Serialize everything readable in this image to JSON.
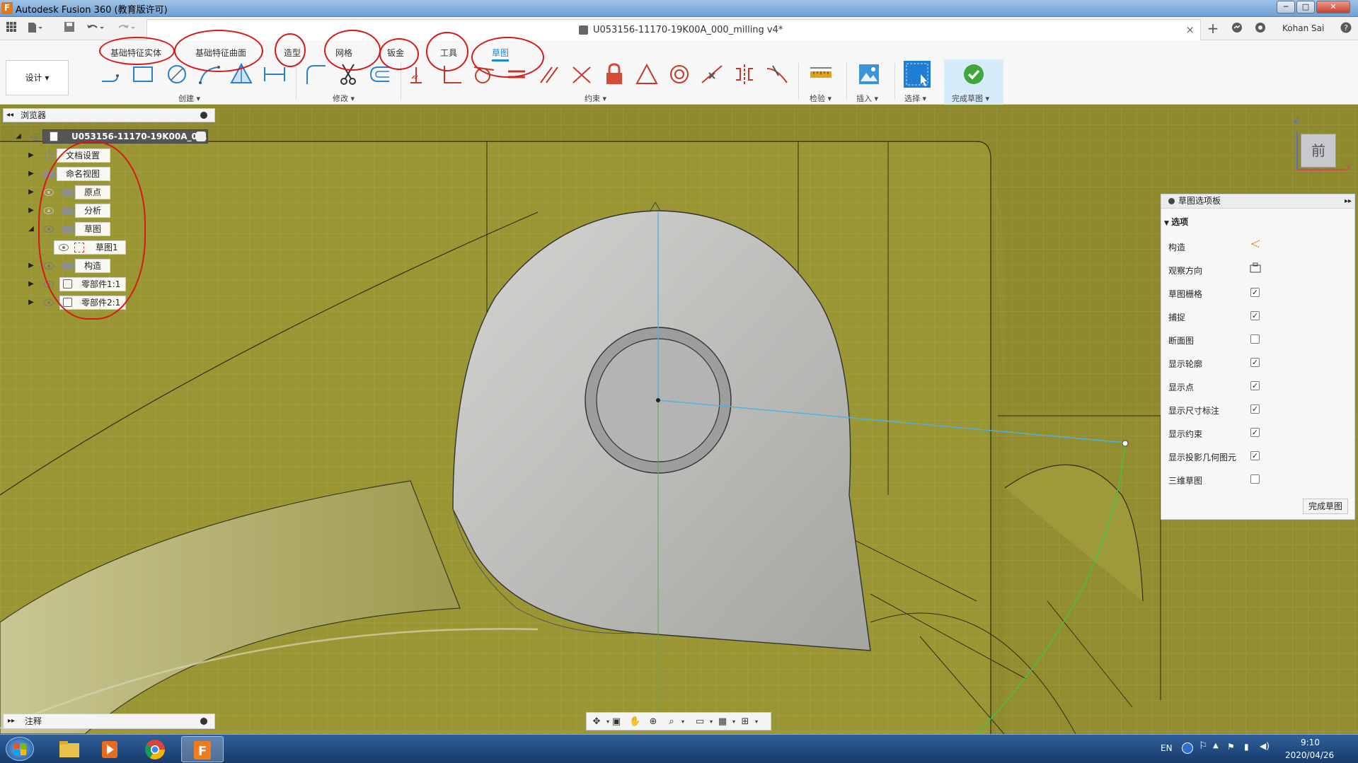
{
  "window": {
    "title": "Autodesk Fusion 360 (教育版许可)",
    "buttons": [
      "─",
      "□",
      "✕"
    ]
  },
  "tabbar": {
    "doc_title": "U053156-11170-19K00A_000_milling v4*",
    "close_glyph": "×",
    "add_glyph": "+",
    "user": "Kohan Sai",
    "help_glyph": "?"
  },
  "ribbon": {
    "workspace": "设计 ▾",
    "tabs": [
      {
        "label": "基础特征实体",
        "active": false
      },
      {
        "label": "基础特征曲面",
        "active": false
      },
      {
        "label": "造型",
        "active": false
      },
      {
        "label": "网格",
        "active": false
      },
      {
        "label": "钣金",
        "active": false
      },
      {
        "label": "工具",
        "active": false
      },
      {
        "label": "草图",
        "active": true
      }
    ],
    "groups": {
      "create": "创建 ▾",
      "modify": "修改 ▾",
      "constraints": "约束 ▾",
      "inspect": "检验 ▾",
      "insert": "插入 ▾",
      "select": "选择 ▾",
      "finish": "完成草图 ▾"
    },
    "accent": "#1a87d9",
    "annotation_color": "#d61818"
  },
  "browser": {
    "title": "浏览器",
    "root": "U053156-11170-19K00A_0...",
    "items": [
      {
        "label": "文档设置",
        "expanded": false,
        "icon": "gear-icon"
      },
      {
        "label": "命名视图",
        "expanded": false,
        "icon": "folder-icon"
      },
      {
        "label": "原点",
        "expanded": false,
        "icon": "folder-icon"
      },
      {
        "label": "分析",
        "expanded": false,
        "icon": "folder-icon"
      },
      {
        "label": "草图",
        "expanded": true,
        "icon": "folder-icon"
      },
      {
        "label": "草图1",
        "expanded": false,
        "icon": "sketch-icon"
      },
      {
        "label": "构造",
        "expanded": false,
        "icon": "folder-icon"
      },
      {
        "label": "零部件1:1",
        "expanded": false,
        "icon": "component-icon"
      },
      {
        "label": "零部件2:1",
        "expanded": false,
        "icon": "component-icon"
      }
    ]
  },
  "viewcube": {
    "face": "前",
    "axis_z": "Z",
    "axis_x": "X"
  },
  "palette": {
    "title": "草图选项板",
    "section": "选项",
    "options": [
      {
        "label": "构造",
        "kind": "icon"
      },
      {
        "label": "观察方向",
        "kind": "icon"
      },
      {
        "label": "草图栅格",
        "checked": true
      },
      {
        "label": "捕捉",
        "checked": true
      },
      {
        "label": "断面图",
        "checked": false
      },
      {
        "label": "显示轮廓",
        "checked": true
      },
      {
        "label": "显示点",
        "checked": true
      },
      {
        "label": "显示尺寸标注",
        "checked": true
      },
      {
        "label": "显示约束",
        "checked": true
      },
      {
        "label": "显示投影几何图元",
        "checked": true
      },
      {
        "label": "三维草图",
        "checked": false
      }
    ],
    "finish": "完成草图"
  },
  "notes": {
    "label": "注释"
  },
  "taskbar": {
    "lang": "EN",
    "time": "9:10",
    "date": "2020/04/26"
  },
  "colors": {
    "model_olive": "#8f8a2c",
    "part_grey": "#b8b8b5",
    "sketch_line": "#4db3e6",
    "sketch_arc": "#41c441"
  }
}
